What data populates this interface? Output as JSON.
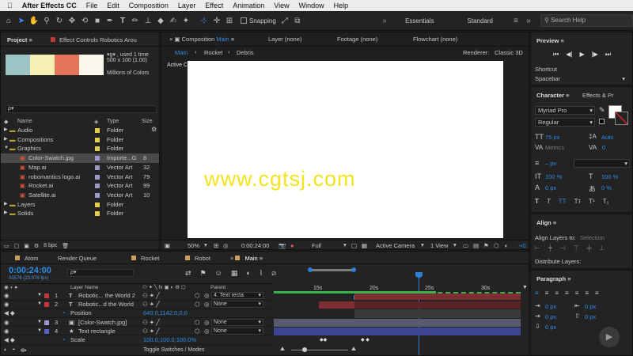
{
  "menubar": {
    "apple": "",
    "items": [
      "After Effects CC",
      "File",
      "Edit",
      "Composition",
      "Layer",
      "Effect",
      "Animation",
      "View",
      "Window",
      "Help"
    ]
  },
  "toolbar": {
    "snapping": "Snapping",
    "workspaces": [
      "Essentials",
      "Standard"
    ],
    "search_placeholder": "Search Help"
  },
  "project": {
    "tab": "Project",
    "effect_controls_tab": "Effect Controls Robotics Arou",
    "thumb_info": [
      "▾g▾ , used 1 time",
      "500 x 100 (1.00)",
      "Millions of Colors"
    ],
    "thumb_colors": [
      "#9fc4c6",
      "#f6efb3",
      "#e2755a",
      "#faf6ec"
    ],
    "search_placeholder": "ρ▾",
    "columns": {
      "name": "Name",
      "type": "Type",
      "size": "Size"
    },
    "items": [
      {
        "name": "Audio",
        "type": "Folder",
        "size": "",
        "kind": "folder",
        "indent": 0,
        "color": "#e2cf4a",
        "open": false
      },
      {
        "name": "Compositions",
        "type": "Folder",
        "size": "",
        "kind": "folder",
        "indent": 0,
        "color": "#e2cf4a",
        "open": false
      },
      {
        "name": "Graphics",
        "type": "Folder",
        "size": "",
        "kind": "folder",
        "indent": 0,
        "color": "#e2cf4a",
        "open": true
      },
      {
        "name": "Color-Swatch.jpg",
        "type": "Importe...G",
        "size": "8",
        "kind": "file",
        "indent": 1,
        "color": "#9a9acb",
        "selected": true
      },
      {
        "name": "Map.ai",
        "type": "Vector Art",
        "size": "32",
        "kind": "file",
        "indent": 1,
        "color": "#9a9acb"
      },
      {
        "name": "robomantics logo.ai",
        "type": "Vector Art",
        "size": "79",
        "kind": "file",
        "indent": 1,
        "color": "#9a9acb"
      },
      {
        "name": "Rocket.ai",
        "type": "Vector Art",
        "size": "99",
        "kind": "file",
        "indent": 1,
        "color": "#9a9acb"
      },
      {
        "name": "Satellite.ai",
        "type": "Vector Art",
        "size": "10",
        "kind": "file",
        "indent": 1,
        "color": "#9a9acb"
      },
      {
        "name": "Layers",
        "type": "Folder",
        "size": "",
        "kind": "folder",
        "indent": 0,
        "color": "#e2cf4a",
        "open": false
      },
      {
        "name": "Solids",
        "type": "Folder",
        "size": "",
        "kind": "folder",
        "indent": 0,
        "color": "#e2cf4a",
        "open": false
      }
    ],
    "bpc": "8 bpc"
  },
  "composition": {
    "tabs": [
      {
        "prefix": "Composition",
        "name": "Main"
      },
      {
        "prefix": "Layer (none)",
        "name": ""
      },
      {
        "prefix": "Footage (none)",
        "name": ""
      },
      {
        "prefix": "Flowchart (none)",
        "name": ""
      }
    ],
    "breadcrumbs": [
      "Main",
      "Rocket",
      "Debris"
    ],
    "renderer": "Renderer:",
    "renderer_value": "Classic 3D",
    "active_camera_label": "Active Camera",
    "watermark": "www.cgtsj.com",
    "bottom": {
      "zoom": "50%",
      "timecode": "0:00:24:00",
      "quality": "Full",
      "camera": "Active Camera",
      "views": "1 View",
      "exposure": "+0."
    }
  },
  "timeline": {
    "tabs": [
      "Atom",
      "Render Queue",
      "Rocket",
      "Robot",
      "Main"
    ],
    "tab_colors": [
      "#c9a15b",
      "",
      "#c9a15b",
      "#c9a15b",
      "#c9a15b"
    ],
    "timecode": "0:00:24:00",
    "frame_info": "00576 (23.976 fps)",
    "search_placeholder": "ρ▾",
    "columns": {
      "layer_name": "Layer Name",
      "parent": "Parent"
    },
    "ticks": [
      "15s",
      "20s",
      "25s",
      "30s"
    ],
    "layers": [
      {
        "num": "1",
        "name": "Robotic... the World 2",
        "kind": "T",
        "color": "#c3363a",
        "parent": "4. Text recta",
        "type": "layer"
      },
      {
        "num": "2",
        "name": "Robotic...d the World",
        "kind": "T",
        "color": "#c3363a",
        "parent": "None",
        "type": "layer"
      },
      {
        "num": "",
        "name": "Position",
        "value": "640.0,1142.0,0.0",
        "type": "prop"
      },
      {
        "num": "3",
        "name": "[Color-Swatch.jpg]",
        "kind": "▣",
        "color": "#9a9acb",
        "parent": "None",
        "type": "layer"
      },
      {
        "num": "4",
        "name": "Text rectangle",
        "kind": "★",
        "color": "#5660c9",
        "parent": "None",
        "type": "layer"
      },
      {
        "num": "",
        "name": "Scale",
        "value": "100.0,100.0,100.0%",
        "type": "prop"
      }
    ],
    "toggle_label": "Toggle Switches / Modes"
  },
  "preview": {
    "title": "Preview",
    "shortcut_label": "Shortcut",
    "shortcut_value": "Spacebar"
  },
  "character": {
    "tabs": [
      "Character",
      "Effects & Pr"
    ],
    "font": "Myriad Pro",
    "style": "Regular",
    "size": "75 px",
    "leading": "Auto",
    "kerning": "Metrics",
    "tracking": "0",
    "stroke": "0",
    "stroke_width": "– px",
    "vscale": "100 %",
    "hscale": "100 %",
    "baseline": "0 px",
    "tsume": "0 %"
  },
  "align": {
    "title": "Align",
    "align_to_label": "Align Layers to:",
    "align_to_value": "Selection",
    "distribute": "Distribute Layers:"
  },
  "paragraph": {
    "title": "Paragraph",
    "values": [
      "0 px",
      "0 px",
      "0 px",
      "0 px",
      "0 px"
    ]
  }
}
